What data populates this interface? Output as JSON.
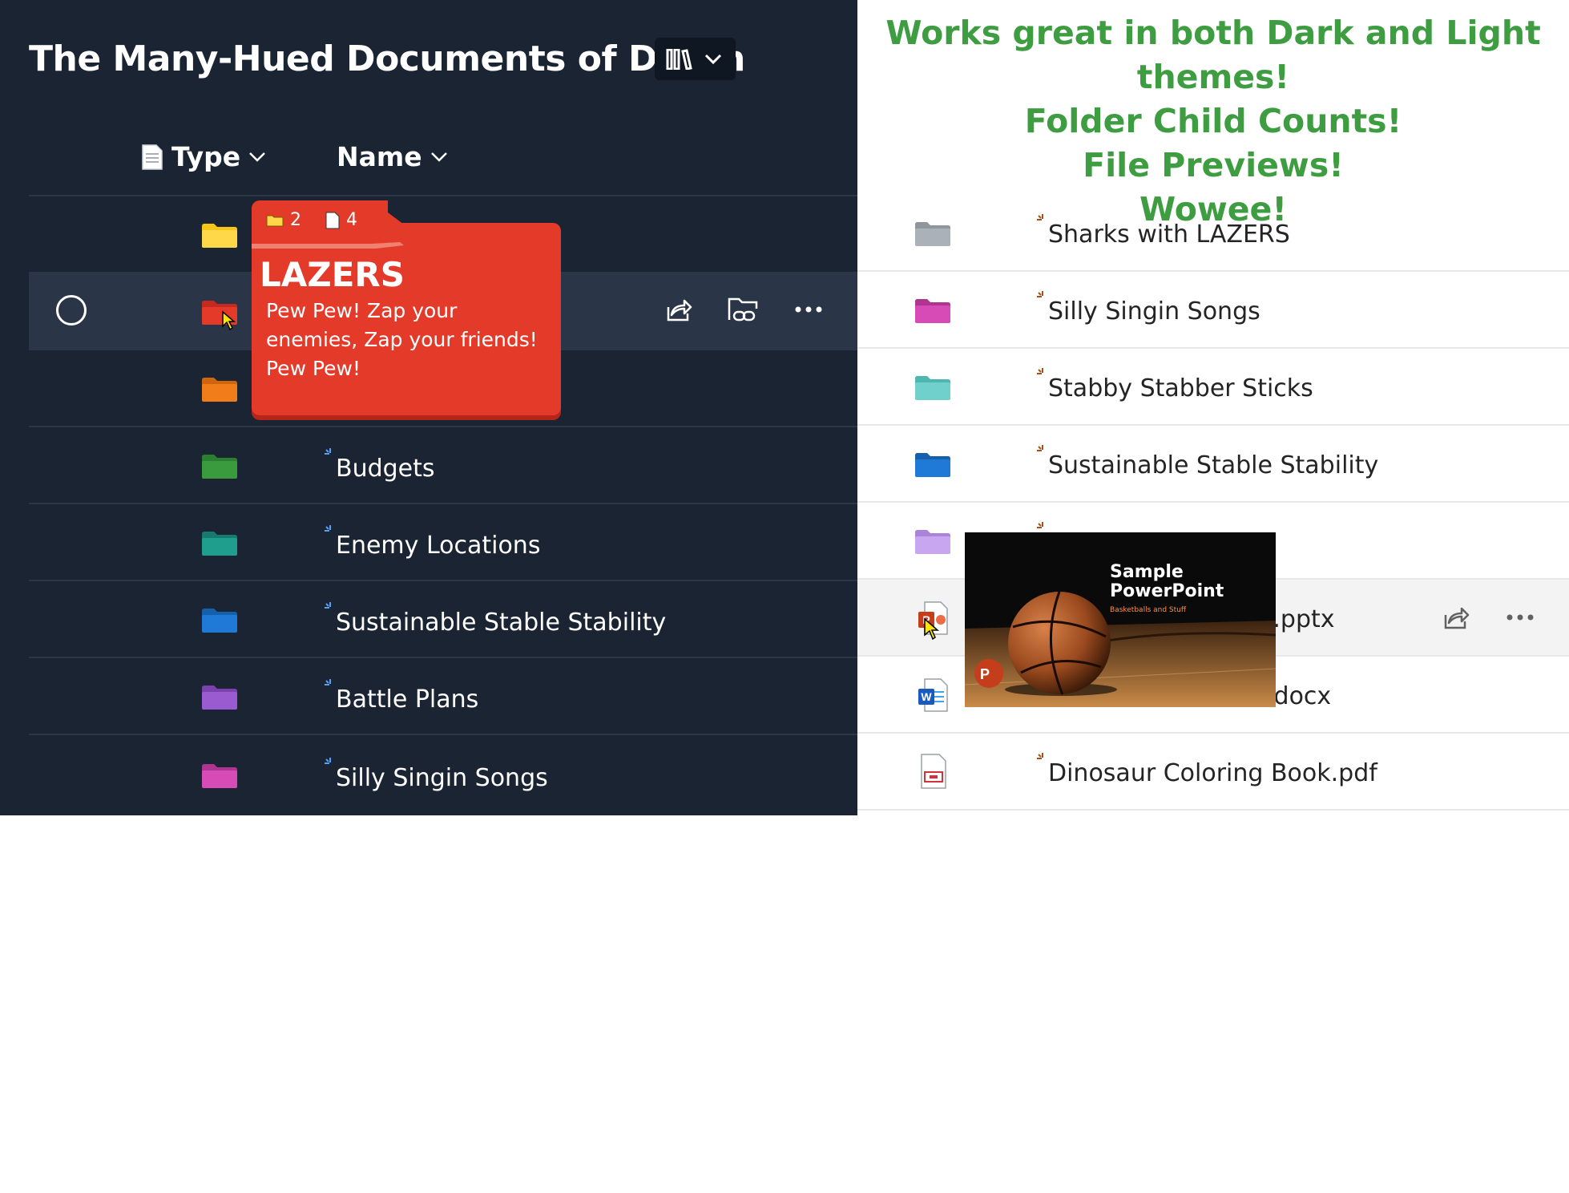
{
  "dark_panel": {
    "title": "The Many-Hued Documents of Death",
    "columns": {
      "type_label": "Type",
      "name_label": "Name"
    },
    "rows": [
      {
        "name": "",
        "folder_color": "#f5c518"
      },
      {
        "name": "",
        "folder_color": "#e43a2a",
        "hovered": true
      },
      {
        "name": "",
        "folder_color": "#f07d1a"
      },
      {
        "name": "Budgets",
        "folder_color": "#3a9a3e"
      },
      {
        "name": "Enemy Locations",
        "folder_color": "#1f9e8e"
      },
      {
        "name": "Sustainable Stable Stability",
        "folder_color": "#1e7ad6"
      },
      {
        "name": "Battle Plans",
        "folder_color": "#9a5ad0"
      },
      {
        "name": "Silly Singin Songs",
        "folder_color": "#d64bb5"
      }
    ],
    "tooltip": {
      "folder_count": "2",
      "file_count": "4",
      "title": "LAZERS",
      "description": "Pew Pew! Zap your enemies, Zap your friends! Pew Pew!",
      "color": "#e43a2a"
    }
  },
  "light_panel": {
    "promo_lines": [
      "Works great in both Dark and Light themes!",
      "Folder Child Counts!",
      "File Previews!",
      "Wowee!"
    ],
    "promo_color": "#3e9d41",
    "rows": [
      {
        "name": "Sharks with LAZERS",
        "icon": "folder-icon",
        "color": "#aab1b8"
      },
      {
        "name": "Silly Singin Songs",
        "icon": "folder-icon",
        "color": "#d64bb5"
      },
      {
        "name": "Stabby Stabber Sticks",
        "icon": "folder-icon",
        "color": "#6fd0cc"
      },
      {
        "name": "Sustainable Stable Stability",
        "icon": "folder-icon",
        "color": "#1e7ad6"
      },
      {
        "name": "",
        "icon": "folder-icon",
        "color": "#c9a6f0"
      },
      {
        "name": "f.pptx",
        "icon": "powerpoint-file-icon",
        "color": "#c43e1c",
        "hovered": true
      },
      {
        "name": ".docx",
        "icon": "word-file-icon",
        "color": "#185abd"
      },
      {
        "name": "Dinosaur Coloring Book.pdf",
        "icon": "pdf-file-icon",
        "color": "#d13438"
      }
    ],
    "preview": {
      "title_line1": "Sample",
      "title_line2": "PowerPoint",
      "subtitle": "Basketballs and Stuff"
    }
  }
}
